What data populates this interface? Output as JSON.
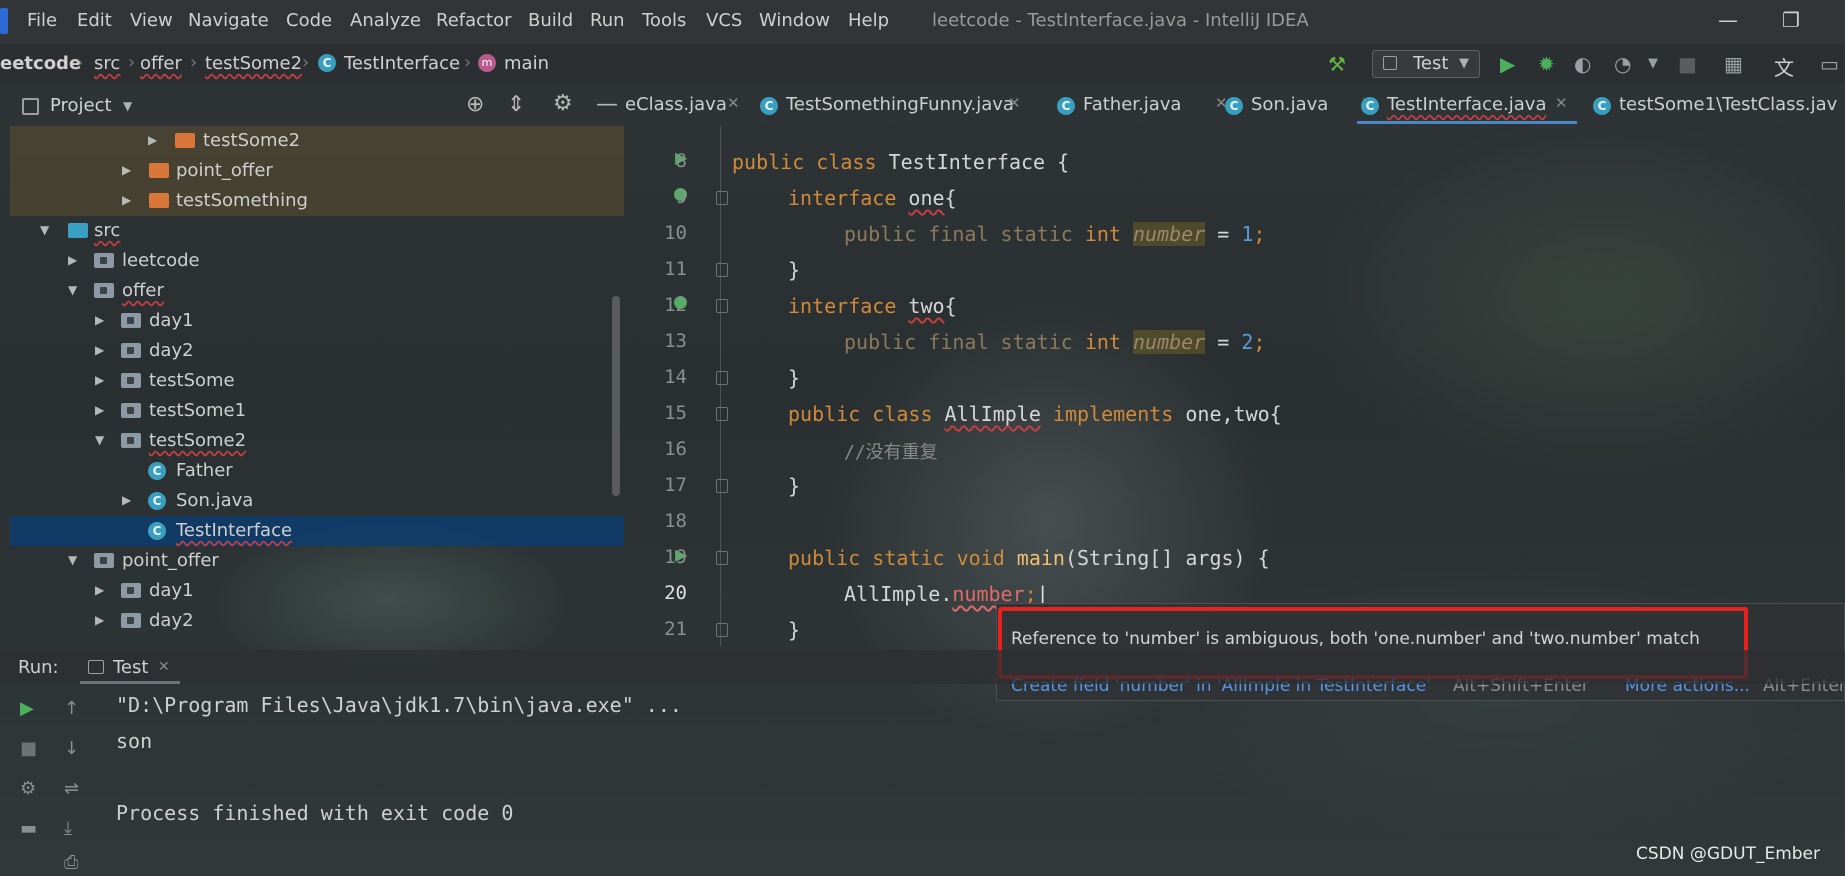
{
  "window": {
    "title": "leetcode - TestInterface.java - IntelliJ IDEA",
    "minimize_icon": "minimize-icon",
    "restore_icon": "restore-icon"
  },
  "menu": [
    "File",
    "Edit",
    "View",
    "Navigate",
    "Code",
    "Analyze",
    "Refactor",
    "Build",
    "Run",
    "Tools",
    "VCS",
    "Window",
    "Help"
  ],
  "breadcrumb": {
    "items": [
      "eetcode",
      "src",
      "offer",
      "testSome2",
      "TestInterface",
      "main"
    ]
  },
  "toolbar": {
    "run_config": "Test",
    "icons": [
      "hammer-icon",
      "run-icon",
      "debug-icon",
      "coverage-icon",
      "profile-icon",
      "stop-icon",
      "project-structure-icon",
      "translate-icon"
    ]
  },
  "project_panel": {
    "title": "Project",
    "tree": [
      {
        "label": "testSome2",
        "kind": "folder-orange",
        "expanded": false
      },
      {
        "label": "point_offer",
        "kind": "folder-orange",
        "expanded": false
      },
      {
        "label": "testSomething",
        "kind": "folder-orange",
        "expanded": false
      },
      {
        "label": "src",
        "kind": "folder-blue",
        "expanded": true
      },
      {
        "label": "leetcode",
        "kind": "package",
        "expanded": false
      },
      {
        "label": "offer",
        "kind": "package",
        "expanded": true
      },
      {
        "label": "day1",
        "kind": "package",
        "expanded": false
      },
      {
        "label": "day2",
        "kind": "package",
        "expanded": false
      },
      {
        "label": "testSome",
        "kind": "package",
        "expanded": false
      },
      {
        "label": "testSome1",
        "kind": "package",
        "expanded": false
      },
      {
        "label": "testSome2",
        "kind": "package",
        "expanded": true
      },
      {
        "label": "Father",
        "kind": "class"
      },
      {
        "label": "Son.java",
        "kind": "class"
      },
      {
        "label": "TestInterface",
        "kind": "class",
        "selected": true
      },
      {
        "label": "point_offer",
        "kind": "package",
        "expanded": true
      },
      {
        "label": "day1",
        "kind": "package",
        "expanded": false
      },
      {
        "label": "day2",
        "kind": "package",
        "expanded": false
      }
    ]
  },
  "tabs": [
    {
      "label": "eClass.java",
      "active": false
    },
    {
      "label": "TestSomethingFunny.java",
      "active": false
    },
    {
      "label": "Father.java",
      "active": false
    },
    {
      "label": "Son.java",
      "active": false
    },
    {
      "label": "TestInterface.java",
      "active": true
    },
    {
      "label": "testSome1\\TestClass.jav",
      "active": false
    }
  ],
  "code": {
    "line_numbers": [
      "8",
      "9",
      "10",
      "11",
      "12",
      "13",
      "14",
      "15",
      "16",
      "17",
      "18",
      "19",
      "20",
      "21"
    ],
    "current_line": "20",
    "l8": {
      "kw": "public class",
      "name": "TestInterface",
      "rest": " {"
    },
    "l9": {
      "kw": "interface",
      "name": "one",
      "rest": "{"
    },
    "l10": {
      "kw": "public final static",
      "type": "int",
      "field": "number",
      "eq": " = ",
      "num": "1",
      "end": ";"
    },
    "l11": {
      "text": "}"
    },
    "l12": {
      "kw": "interface",
      "name": "two",
      "rest": "{"
    },
    "l13": {
      "kw": "public final static",
      "type": "int",
      "field": "number",
      "eq": " = ",
      "num": "2",
      "end": ";"
    },
    "l14": {
      "text": "}"
    },
    "l15": {
      "kw": "public class",
      "name": "AllImple",
      "kw2": "implements",
      "rest": "one,two{"
    },
    "l16": {
      "comment": "//没有重复"
    },
    "l17": {
      "text": "}"
    },
    "l19": {
      "kw": "public static void",
      "name": "main",
      "rest": "(String[] args) {"
    },
    "l20": {
      "obj": "AllImple.",
      "field": "number",
      "end": ";"
    },
    "l21": {
      "text": "}"
    }
  },
  "tooltip": {
    "message": "Reference to 'number' is ambiguous, both 'one.number' and 'two.number' match",
    "fix_link": "Create field 'number' in 'AllImple in TestInterface'",
    "fix_shortcut": "Alt+Shift+Enter",
    "more_link": "More actions...",
    "more_shortcut": "Alt+Enter"
  },
  "run_panel": {
    "label": "Run:",
    "tab": "Test",
    "console": [
      "\"D:\\Program Files\\Java\\jdk1.7\\bin\\java.exe\" ...",
      "son",
      "",
      "Process finished with exit code 0"
    ]
  },
  "watermark": "CSDN @GDUT_Ember"
}
